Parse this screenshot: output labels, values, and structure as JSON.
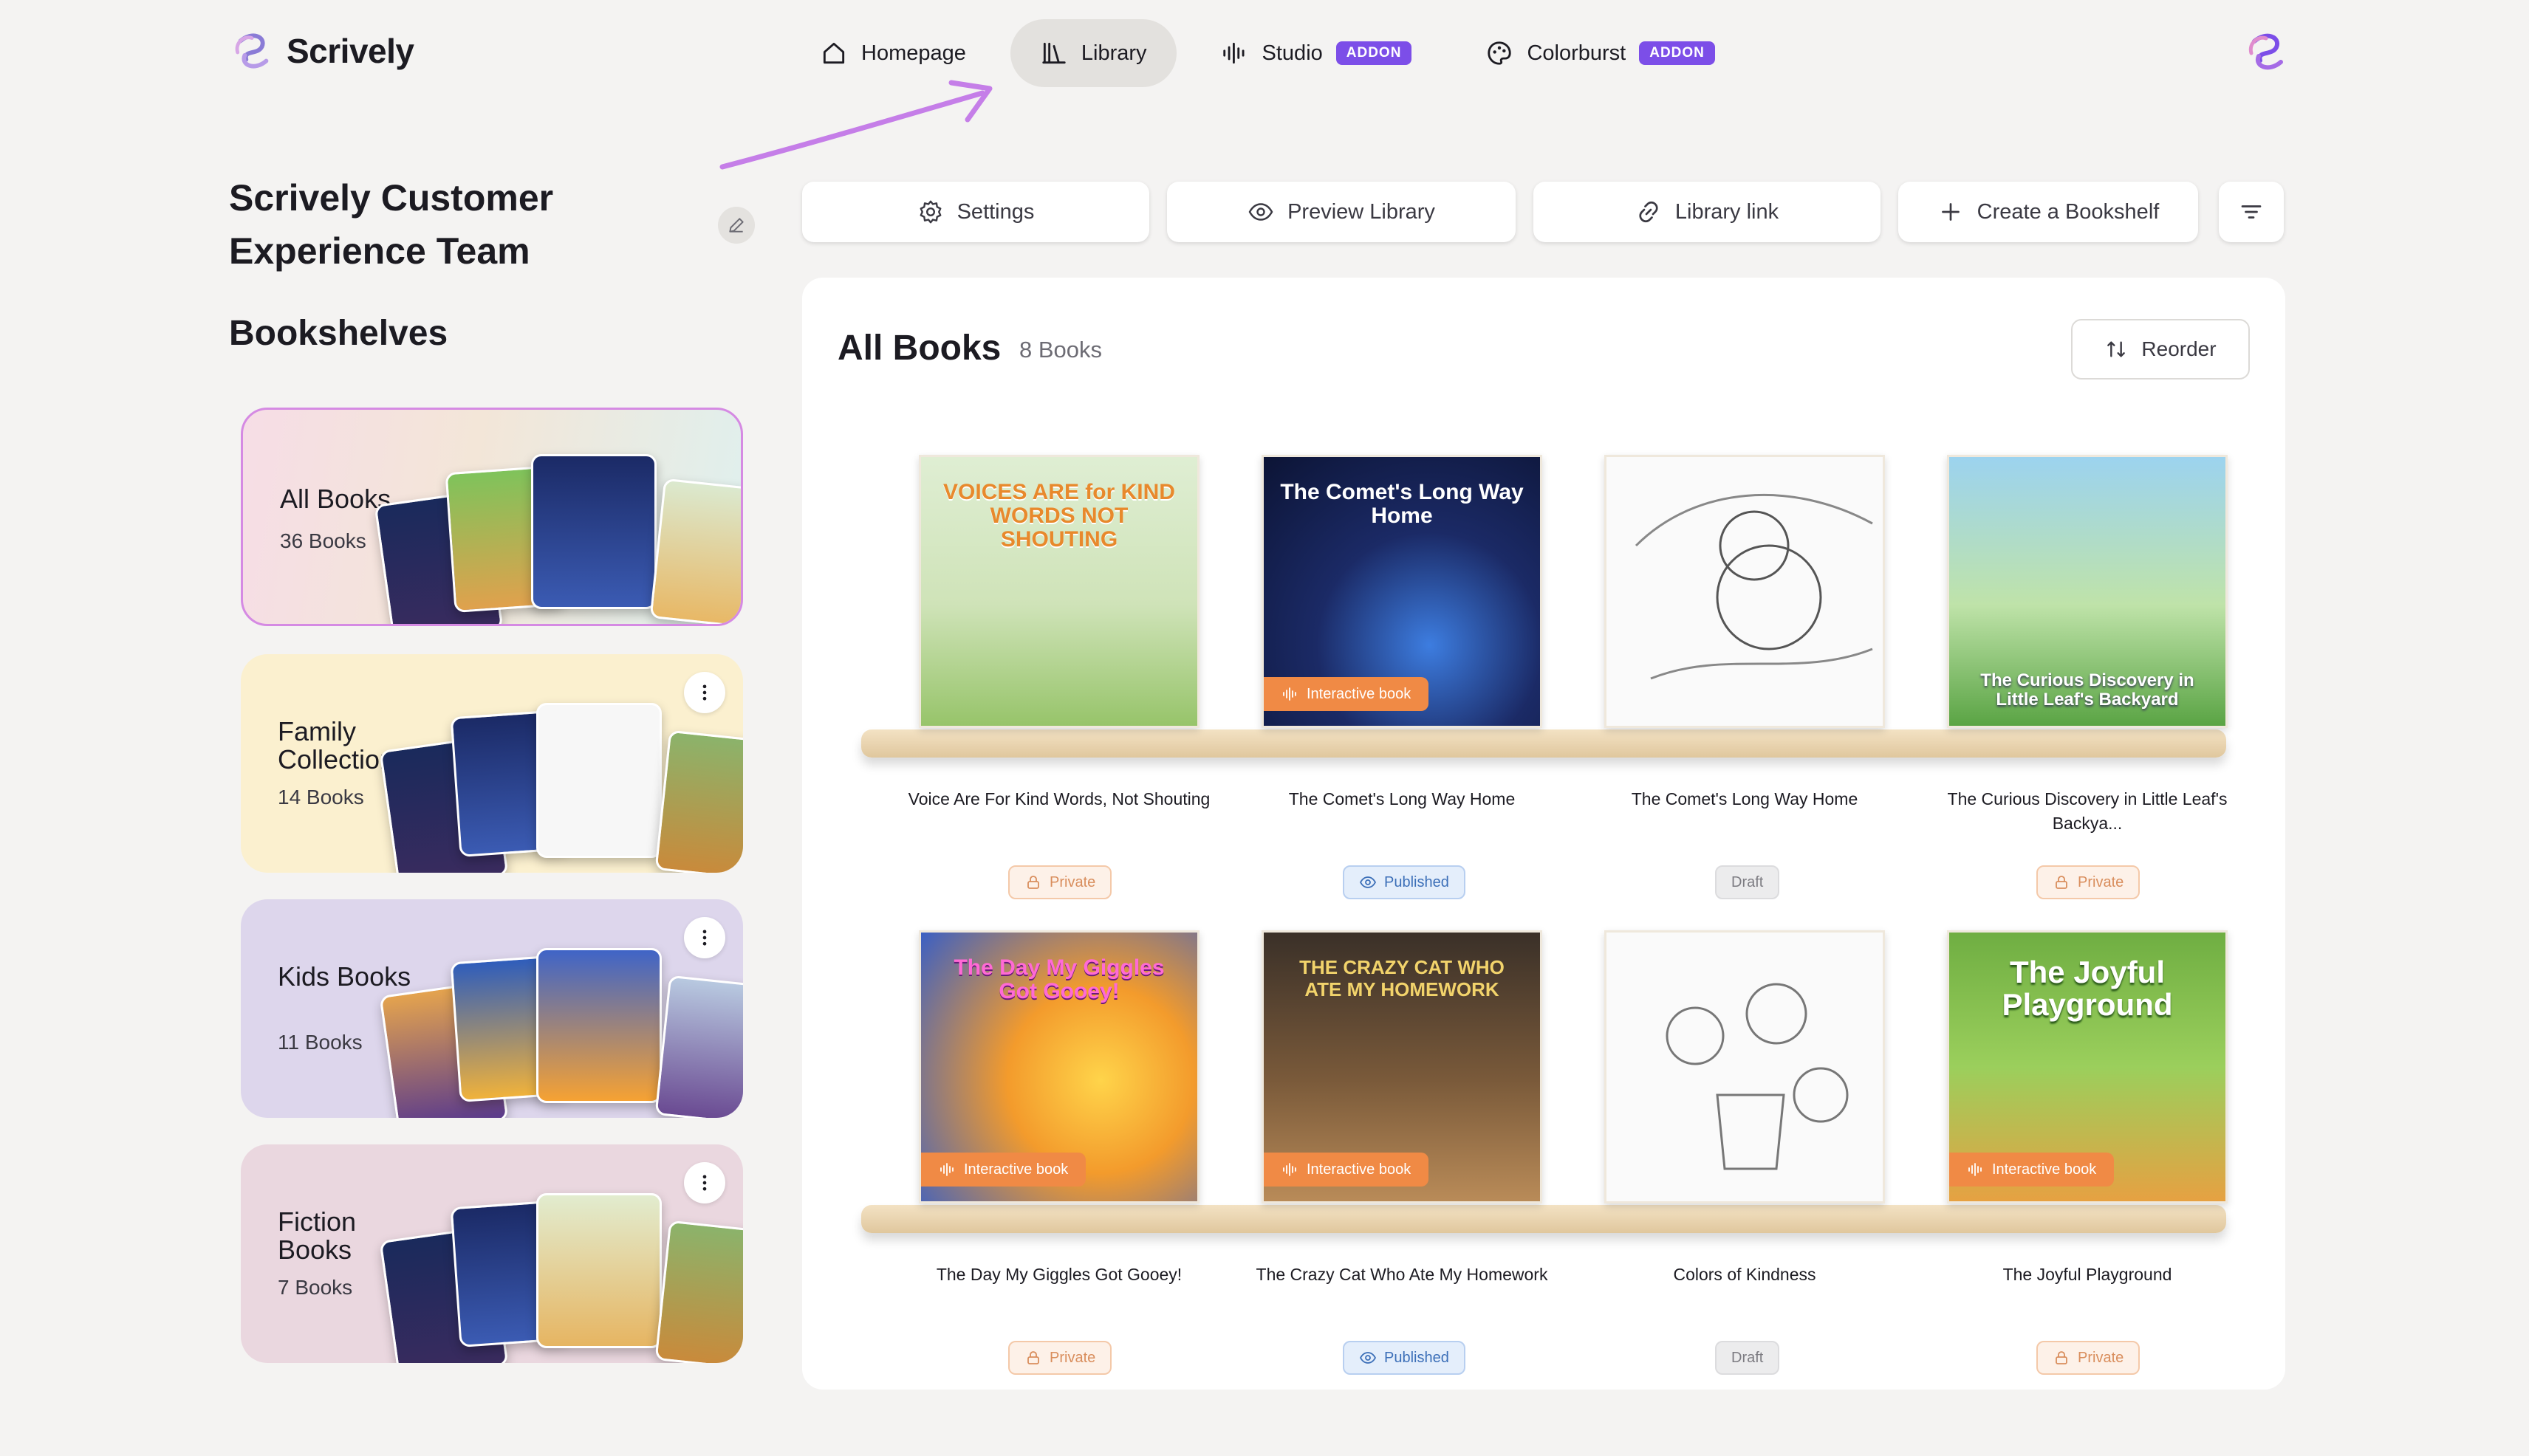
{
  "brand": {
    "name": "Scrively"
  },
  "nav": {
    "items": [
      {
        "label": "Homepage"
      },
      {
        "label": "Library"
      },
      {
        "label": "Studio",
        "badge": "ADDON"
      },
      {
        "label": "Colorburst",
        "badge": "ADDON"
      }
    ],
    "active": "Library"
  },
  "sidebar": {
    "team_name": "Scrively Customer Experience Team",
    "section_title": "Bookshelves",
    "shelves": [
      {
        "title": "All Books",
        "count": "36 Books"
      },
      {
        "title": "Family Collection",
        "count": "14 Books"
      },
      {
        "title": "Kids Books",
        "count": "11 Books"
      },
      {
        "title": "Fiction Books",
        "count": "7 Books"
      }
    ]
  },
  "actions": {
    "settings": "Settings",
    "preview": "Preview Library",
    "link": "Library link",
    "create": "Create a Bookshelf"
  },
  "main": {
    "title": "All Books",
    "count": "8 Books",
    "reorder": "Reorder",
    "books": [
      {
        "title": "Voice Are For Kind Words, Not Shouting",
        "cover_text": "VOICES ARE for KIND WORDS NOT SHOUTING",
        "status": "Private",
        "tag": ""
      },
      {
        "title": "The Comet's Long Way Home",
        "cover_text": "The Comet's Long Way Home",
        "status": "Published",
        "tag": "Interactive book"
      },
      {
        "title": "The Comet's Long Way Home",
        "cover_text": "",
        "status": "Draft",
        "tag": ""
      },
      {
        "title": "The Curious Discovery in Little Leaf's Backya...",
        "cover_text": "The Curious Discovery in Little Leaf's Backyard",
        "status": "Private",
        "tag": ""
      },
      {
        "title": "The Day My Giggles Got Gooey!",
        "cover_text": "The Day My Giggles Got Gooey!",
        "status": "Private",
        "tag": "Interactive book"
      },
      {
        "title": "The Crazy Cat Who Ate My Homework",
        "cover_text": "THE CRAZY CAT WHO ATE MY HOMEWORK",
        "status": "Published",
        "tag": "Interactive book"
      },
      {
        "title": "Colors of Kindness",
        "cover_text": "",
        "status": "Draft",
        "tag": ""
      },
      {
        "title": "The Joyful Playground",
        "cover_text": "The Joyful Playground",
        "status": "Private",
        "tag": "Interactive book"
      }
    ]
  },
  "colors": {
    "accent": "#7c4ee8",
    "tag": "#f08a45",
    "background": "#f4f3f2"
  }
}
